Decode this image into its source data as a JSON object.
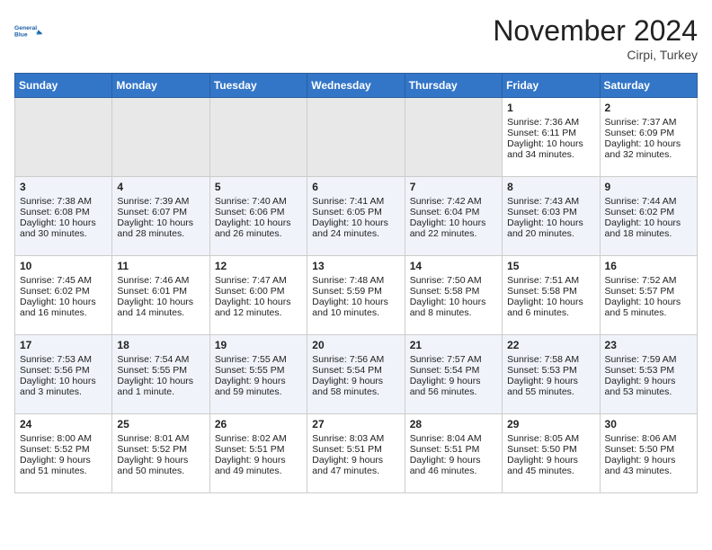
{
  "header": {
    "logo_line1": "General",
    "logo_line2": "Blue",
    "month": "November 2024",
    "location": "Cirpi, Turkey"
  },
  "days_of_week": [
    "Sunday",
    "Monday",
    "Tuesday",
    "Wednesday",
    "Thursday",
    "Friday",
    "Saturday"
  ],
  "weeks": [
    [
      {
        "day": "",
        "empty": true
      },
      {
        "day": "",
        "empty": true
      },
      {
        "day": "",
        "empty": true
      },
      {
        "day": "",
        "empty": true
      },
      {
        "day": "",
        "empty": true
      },
      {
        "day": "1",
        "sunrise": "7:36 AM",
        "sunset": "6:11 PM",
        "daylight": "10 hours and 34 minutes."
      },
      {
        "day": "2",
        "sunrise": "7:37 AM",
        "sunset": "6:09 PM",
        "daylight": "10 hours and 32 minutes."
      }
    ],
    [
      {
        "day": "3",
        "sunrise": "7:38 AM",
        "sunset": "6:08 PM",
        "daylight": "10 hours and 30 minutes."
      },
      {
        "day": "4",
        "sunrise": "7:39 AM",
        "sunset": "6:07 PM",
        "daylight": "10 hours and 28 minutes."
      },
      {
        "day": "5",
        "sunrise": "7:40 AM",
        "sunset": "6:06 PM",
        "daylight": "10 hours and 26 minutes."
      },
      {
        "day": "6",
        "sunrise": "7:41 AM",
        "sunset": "6:05 PM",
        "daylight": "10 hours and 24 minutes."
      },
      {
        "day": "7",
        "sunrise": "7:42 AM",
        "sunset": "6:04 PM",
        "daylight": "10 hours and 22 minutes."
      },
      {
        "day": "8",
        "sunrise": "7:43 AM",
        "sunset": "6:03 PM",
        "daylight": "10 hours and 20 minutes."
      },
      {
        "day": "9",
        "sunrise": "7:44 AM",
        "sunset": "6:02 PM",
        "daylight": "10 hours and 18 minutes."
      }
    ],
    [
      {
        "day": "10",
        "sunrise": "7:45 AM",
        "sunset": "6:02 PM",
        "daylight": "10 hours and 16 minutes."
      },
      {
        "day": "11",
        "sunrise": "7:46 AM",
        "sunset": "6:01 PM",
        "daylight": "10 hours and 14 minutes."
      },
      {
        "day": "12",
        "sunrise": "7:47 AM",
        "sunset": "6:00 PM",
        "daylight": "10 hours and 12 minutes."
      },
      {
        "day": "13",
        "sunrise": "7:48 AM",
        "sunset": "5:59 PM",
        "daylight": "10 hours and 10 minutes."
      },
      {
        "day": "14",
        "sunrise": "7:50 AM",
        "sunset": "5:58 PM",
        "daylight": "10 hours and 8 minutes."
      },
      {
        "day": "15",
        "sunrise": "7:51 AM",
        "sunset": "5:58 PM",
        "daylight": "10 hours and 6 minutes."
      },
      {
        "day": "16",
        "sunrise": "7:52 AM",
        "sunset": "5:57 PM",
        "daylight": "10 hours and 5 minutes."
      }
    ],
    [
      {
        "day": "17",
        "sunrise": "7:53 AM",
        "sunset": "5:56 PM",
        "daylight": "10 hours and 3 minutes."
      },
      {
        "day": "18",
        "sunrise": "7:54 AM",
        "sunset": "5:55 PM",
        "daylight": "10 hours and 1 minute."
      },
      {
        "day": "19",
        "sunrise": "7:55 AM",
        "sunset": "5:55 PM",
        "daylight": "9 hours and 59 minutes."
      },
      {
        "day": "20",
        "sunrise": "7:56 AM",
        "sunset": "5:54 PM",
        "daylight": "9 hours and 58 minutes."
      },
      {
        "day": "21",
        "sunrise": "7:57 AM",
        "sunset": "5:54 PM",
        "daylight": "9 hours and 56 minutes."
      },
      {
        "day": "22",
        "sunrise": "7:58 AM",
        "sunset": "5:53 PM",
        "daylight": "9 hours and 55 minutes."
      },
      {
        "day": "23",
        "sunrise": "7:59 AM",
        "sunset": "5:53 PM",
        "daylight": "9 hours and 53 minutes."
      }
    ],
    [
      {
        "day": "24",
        "sunrise": "8:00 AM",
        "sunset": "5:52 PM",
        "daylight": "9 hours and 51 minutes."
      },
      {
        "day": "25",
        "sunrise": "8:01 AM",
        "sunset": "5:52 PM",
        "daylight": "9 hours and 50 minutes."
      },
      {
        "day": "26",
        "sunrise": "8:02 AM",
        "sunset": "5:51 PM",
        "daylight": "9 hours and 49 minutes."
      },
      {
        "day": "27",
        "sunrise": "8:03 AM",
        "sunset": "5:51 PM",
        "daylight": "9 hours and 47 minutes."
      },
      {
        "day": "28",
        "sunrise": "8:04 AM",
        "sunset": "5:51 PM",
        "daylight": "9 hours and 46 minutes."
      },
      {
        "day": "29",
        "sunrise": "8:05 AM",
        "sunset": "5:50 PM",
        "daylight": "9 hours and 45 minutes."
      },
      {
        "day": "30",
        "sunrise": "8:06 AM",
        "sunset": "5:50 PM",
        "daylight": "9 hours and 43 minutes."
      }
    ]
  ]
}
